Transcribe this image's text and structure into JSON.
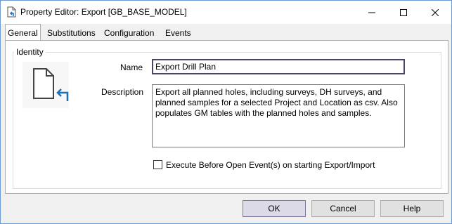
{
  "window": {
    "title": "Property Editor: Export [GB_BASE_MODEL]",
    "icons": {
      "app": "document-export-icon",
      "minimize": "minimize-icon",
      "maximize": "maximize-icon",
      "close": "close-icon"
    }
  },
  "tabs": [
    {
      "label": "General",
      "active": true
    },
    {
      "label": "Substitutions",
      "active": false
    },
    {
      "label": "Configuration",
      "active": false
    },
    {
      "label": "Events",
      "active": false
    }
  ],
  "identity": {
    "group_label": "Identity",
    "icon": "document-export-icon",
    "name_label": "Name",
    "name_value": "Export Drill Plan",
    "description_label": "Description",
    "description_value": "Export all planned holes, including surveys, DH surveys, and planned samples for a selected Project and Location as csv. Also populates GM tables with the planned holes and samples.",
    "checkbox_label": "Execute Before Open Event(s) on starting Export/Import",
    "checkbox_checked": false
  },
  "buttons": {
    "ok": "OK",
    "cancel": "Cancel",
    "help": "Help"
  },
  "colors": {
    "window_border": "#6b9bd1",
    "icon_blue": "#1f6fb8",
    "focus_border": "#4a4564"
  }
}
